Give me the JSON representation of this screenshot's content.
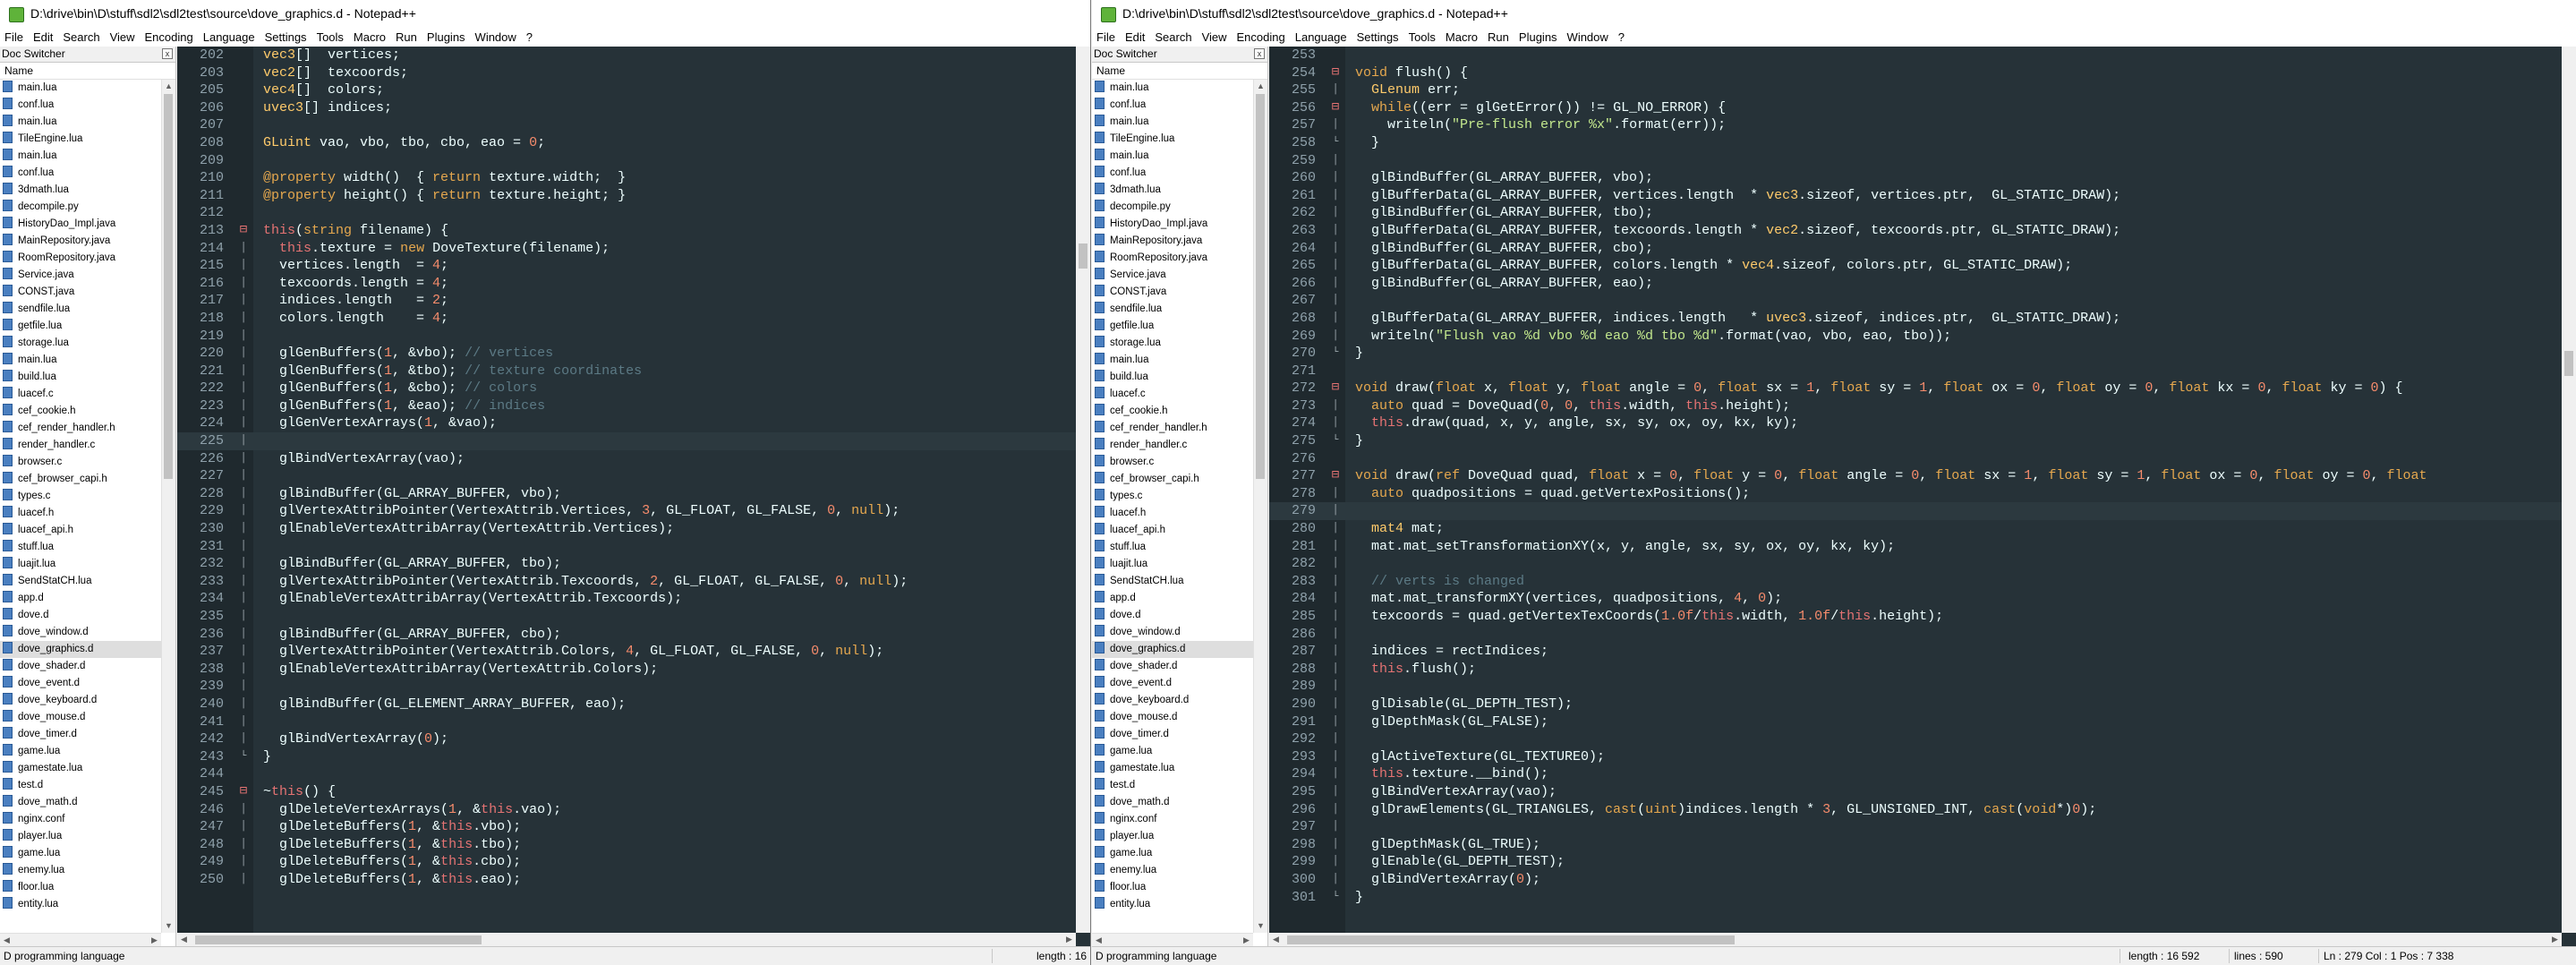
{
  "left": {
    "title": "D:\\drive\\bin\\D\\stuff\\sdl2\\sdl2test\\source\\dove_graphics.d - Notepad++",
    "menu": [
      "File",
      "Edit",
      "Search",
      "View",
      "Encoding",
      "Language",
      "Settings",
      "Tools",
      "Macro",
      "Run",
      "Plugins",
      "Window",
      "?"
    ],
    "panel": {
      "title": "Doc Switcher",
      "close": "x",
      "column": "Name",
      "items": [
        "main.lua",
        "conf.lua",
        "main.lua",
        "TileEngine.lua",
        "main.lua",
        "conf.lua",
        "3dmath.lua",
        "decompile.py",
        "HistoryDao_Impl.java",
        "MainRepository.java",
        "RoomRepository.java",
        "Service.java",
        "CONST.java",
        "sendfile.lua",
        "getfile.lua",
        "storage.lua",
        "main.lua",
        "build.lua",
        "luacef.c",
        "cef_cookie.h",
        "cef_render_handler.h",
        "render_handler.c",
        "browser.c",
        "cef_browser_capi.h",
        "types.c",
        "luacef.h",
        "luacef_api.h",
        "stuff.lua",
        "luajit.lua",
        "SendStatCH.lua",
        "app.d",
        "dove.d",
        "dove_window.d",
        "dove_graphics.d",
        "dove_shader.d",
        "dove_event.d",
        "dove_keyboard.d",
        "dove_mouse.d",
        "dove_timer.d",
        "game.lua",
        "gamestate.lua",
        "test.d",
        "dove_math.d",
        "nginx.conf",
        "player.lua",
        "game.lua",
        "enemy.lua",
        "floor.lua",
        "entity.lua"
      ],
      "active_index": 33
    },
    "status": {
      "lang": "D programming language",
      "length": "length : 16"
    },
    "lines": [
      {
        "n": "202",
        "f": "",
        "h": "<span class=\"t\">vec3</span>[]  vertices;"
      },
      {
        "n": "203",
        "f": "",
        "h": "<span class=\"t\">vec2</span>[]  texcoords;"
      },
      {
        "n": "205",
        "f": "",
        "h": "<span class=\"t\">vec4</span>[]  colors;"
      },
      {
        "n": "206",
        "f": "",
        "h": "<span class=\"t\">uvec3</span>[] indices;"
      },
      {
        "n": "207",
        "f": "",
        "h": ""
      },
      {
        "n": "208",
        "f": "",
        "h": "<span class=\"t\">GLuint</span> vao, vbo, tbo, cbo, eao = <span class=\"n\">0</span>;"
      },
      {
        "n": "209",
        "f": "",
        "h": ""
      },
      {
        "n": "210",
        "f": "",
        "h": "<span class=\"k\">@property</span> width()  { <span class=\"k\">return</span> texture.width;  }"
      },
      {
        "n": "211",
        "f": "",
        "h": "<span class=\"k\">@property</span> height() { <span class=\"k\">return</span> texture.height; }"
      },
      {
        "n": "212",
        "f": "",
        "h": ""
      },
      {
        "n": "213",
        "f": "start",
        "h": "<span class=\"r\">this</span>(<span class=\"k\">string</span> filename) {"
      },
      {
        "n": "214",
        "f": "bar",
        "h": "  <span class=\"r\">this</span>.texture = <span class=\"k\">new</span> DoveTexture(filename);"
      },
      {
        "n": "215",
        "f": "bar",
        "h": "  vertices.length  = <span class=\"n\">4</span>;"
      },
      {
        "n": "216",
        "f": "bar",
        "h": "  texcoords.length = <span class=\"n\">4</span>;"
      },
      {
        "n": "217",
        "f": "bar",
        "h": "  indices.length   = <span class=\"n\">2</span>;"
      },
      {
        "n": "218",
        "f": "bar",
        "h": "  colors.length    = <span class=\"n\">4</span>;"
      },
      {
        "n": "219",
        "f": "bar",
        "h": ""
      },
      {
        "n": "220",
        "f": "bar",
        "h": "  glGenBuffers(<span class=\"n\">1</span>, &amp;vbo); <span class=\"c\">// vertices</span>"
      },
      {
        "n": "221",
        "f": "bar",
        "h": "  glGenBuffers(<span class=\"n\">1</span>, &amp;tbo); <span class=\"c\">// texture coordinates</span>"
      },
      {
        "n": "222",
        "f": "bar",
        "h": "  glGenBuffers(<span class=\"n\">1</span>, &amp;cbo); <span class=\"c\">// colors</span>"
      },
      {
        "n": "223",
        "f": "bar",
        "h": "  glGenBuffers(<span class=\"n\">1</span>, &amp;eao); <span class=\"c\">// indices</span>"
      },
      {
        "n": "224",
        "f": "bar",
        "h": "  glGenVertexArrays(<span class=\"n\">1</span>, &amp;vao);"
      },
      {
        "n": "225",
        "f": "bar",
        "h": "",
        "caret": true
      },
      {
        "n": "226",
        "f": "bar",
        "h": "  glBindVertexArray(vao);"
      },
      {
        "n": "227",
        "f": "bar",
        "h": ""
      },
      {
        "n": "228",
        "f": "bar",
        "h": "  glBindBuffer(GL_ARRAY_BUFFER, vbo);"
      },
      {
        "n": "229",
        "f": "bar",
        "h": "  glVertexAttribPointer(VertexAttrib.Vertices, <span class=\"n\">3</span>, GL_FLOAT, GL_FALSE, <span class=\"n\">0</span>, <span class=\"k\">null</span>);"
      },
      {
        "n": "230",
        "f": "bar",
        "h": "  glEnableVertexAttribArray(VertexAttrib.Vertices);"
      },
      {
        "n": "231",
        "f": "bar",
        "h": ""
      },
      {
        "n": "232",
        "f": "bar",
        "h": "  glBindBuffer(GL_ARRAY_BUFFER, tbo);"
      },
      {
        "n": "233",
        "f": "bar",
        "h": "  glVertexAttribPointer(VertexAttrib.Texcoords, <span class=\"n\">2</span>, GL_FLOAT, GL_FALSE, <span class=\"n\">0</span>, <span class=\"k\">null</span>);"
      },
      {
        "n": "234",
        "f": "bar",
        "h": "  glEnableVertexAttribArray(VertexAttrib.Texcoords);"
      },
      {
        "n": "235",
        "f": "bar",
        "h": ""
      },
      {
        "n": "236",
        "f": "bar",
        "h": "  glBindBuffer(GL_ARRAY_BUFFER, cbo);"
      },
      {
        "n": "237",
        "f": "bar",
        "h": "  glVertexAttribPointer(VertexAttrib.Colors, <span class=\"n\">4</span>, GL_FLOAT, GL_FALSE, <span class=\"n\">0</span>, <span class=\"k\">null</span>);"
      },
      {
        "n": "238",
        "f": "bar",
        "h": "  glEnableVertexAttribArray(VertexAttrib.Colors);"
      },
      {
        "n": "239",
        "f": "bar",
        "h": ""
      },
      {
        "n": "240",
        "f": "bar",
        "h": "  glBindBuffer(GL_ELEMENT_ARRAY_BUFFER, eao);"
      },
      {
        "n": "241",
        "f": "bar",
        "h": ""
      },
      {
        "n": "242",
        "f": "bar",
        "h": "  glBindVertexArray(<span class=\"n\">0</span>);"
      },
      {
        "n": "243",
        "f": "end",
        "h": "}"
      },
      {
        "n": "244",
        "f": "",
        "h": ""
      },
      {
        "n": "245",
        "f": "start",
        "h": "~<span class=\"r\">this</span>() {"
      },
      {
        "n": "246",
        "f": "bar",
        "h": "  glDeleteVertexArrays(<span class=\"n\">1</span>, &amp;<span class=\"r\">this</span>.vao);"
      },
      {
        "n": "247",
        "f": "bar",
        "h": "  glDeleteBuffers(<span class=\"n\">1</span>, &amp;<span class=\"r\">this</span>.vbo);"
      },
      {
        "n": "248",
        "f": "bar",
        "h": "  glDeleteBuffers(<span class=\"n\">1</span>, &amp;<span class=\"r\">this</span>.tbo);"
      },
      {
        "n": "249",
        "f": "bar",
        "h": "  glDeleteBuffers(<span class=\"n\">1</span>, &amp;<span class=\"r\">this</span>.cbo);"
      },
      {
        "n": "250",
        "f": "bar",
        "h": "  glDeleteBuffers(<span class=\"n\">1</span>, &amp;<span class=\"r\">this</span>.eao);"
      }
    ]
  },
  "right": {
    "title": "D:\\drive\\bin\\D\\stuff\\sdl2\\sdl2test\\source\\dove_graphics.d - Notepad++",
    "menu": [
      "File",
      "Edit",
      "Search",
      "View",
      "Encoding",
      "Language",
      "Settings",
      "Tools",
      "Macro",
      "Run",
      "Plugins",
      "Window",
      "?"
    ],
    "panel": {
      "title": "Doc Switcher",
      "close": "x",
      "column": "Name",
      "items": [
        "main.lua",
        "conf.lua",
        "main.lua",
        "TileEngine.lua",
        "main.lua",
        "conf.lua",
        "3dmath.lua",
        "decompile.py",
        "HistoryDao_Impl.java",
        "MainRepository.java",
        "RoomRepository.java",
        "Service.java",
        "CONST.java",
        "sendfile.lua",
        "getfile.lua",
        "storage.lua",
        "main.lua",
        "build.lua",
        "luacef.c",
        "cef_cookie.h",
        "cef_render_handler.h",
        "render_handler.c",
        "browser.c",
        "cef_browser_capi.h",
        "types.c",
        "luacef.h",
        "luacef_api.h",
        "stuff.lua",
        "luajit.lua",
        "SendStatCH.lua",
        "app.d",
        "dove.d",
        "dove_window.d",
        "dove_graphics.d",
        "dove_shader.d",
        "dove_event.d",
        "dove_keyboard.d",
        "dove_mouse.d",
        "dove_timer.d",
        "game.lua",
        "gamestate.lua",
        "test.d",
        "dove_math.d",
        "nginx.conf",
        "player.lua",
        "game.lua",
        "enemy.lua",
        "floor.lua",
        "entity.lua"
      ],
      "active_index": 33
    },
    "status": {
      "lang": "D programming language",
      "length": "length : 16 592",
      "lines": "lines : 590",
      "pos": "Ln : 279   Col : 1   Pos : 7 338"
    },
    "lines": [
      {
        "n": "253",
        "f": "",
        "h": ""
      },
      {
        "n": "254",
        "f": "start",
        "h": "<span class=\"k\">void</span> flush() {"
      },
      {
        "n": "255",
        "f": "bar",
        "h": "  <span class=\"t\">GLenum</span> err;"
      },
      {
        "n": "256",
        "f": "start",
        "h": "  <span class=\"k\">while</span>((err = glGetError()) != GL_NO_ERROR) {"
      },
      {
        "n": "257",
        "f": "bar",
        "h": "    writeln(<span class=\"s\">\"Pre-flush error %x\"</span>.format(err));"
      },
      {
        "n": "258",
        "f": "end",
        "h": "  }"
      },
      {
        "n": "259",
        "f": "bar",
        "h": ""
      },
      {
        "n": "260",
        "f": "bar",
        "h": "  glBindBuffer(GL_ARRAY_BUFFER, vbo);"
      },
      {
        "n": "261",
        "f": "bar",
        "h": "  glBufferData(GL_ARRAY_BUFFER, vertices.length  * <span class=\"t\">vec3</span>.sizeof, vertices.ptr,  GL_STATIC_DRAW);"
      },
      {
        "n": "262",
        "f": "bar",
        "h": "  glBindBuffer(GL_ARRAY_BUFFER, tbo);"
      },
      {
        "n": "263",
        "f": "bar",
        "h": "  glBufferData(GL_ARRAY_BUFFER, texcoords.length * <span class=\"t\">vec2</span>.sizeof, texcoords.ptr, GL_STATIC_DRAW);"
      },
      {
        "n": "264",
        "f": "bar",
        "h": "  glBindBuffer(GL_ARRAY_BUFFER, cbo);"
      },
      {
        "n": "265",
        "f": "bar",
        "h": "  glBufferData(GL_ARRAY_BUFFER, colors.length * <span class=\"t\">vec4</span>.sizeof, colors.ptr, GL_STATIC_DRAW);"
      },
      {
        "n": "266",
        "f": "bar",
        "h": "  glBindBuffer(GL_ARRAY_BUFFER, eao);"
      },
      {
        "n": "267",
        "f": "bar",
        "h": ""
      },
      {
        "n": "268",
        "f": "bar",
        "h": "  glBufferData(GL_ARRAY_BUFFER, indices.length   * <span class=\"t\">uvec3</span>.sizeof, indices.ptr,  GL_STATIC_DRAW);"
      },
      {
        "n": "269",
        "f": "bar",
        "h": "  writeln(<span class=\"s\">\"Flush vao %d vbo %d eao %d tbo %d\"</span>.format(vao, vbo, eao, tbo));"
      },
      {
        "n": "270",
        "f": "end",
        "h": "}"
      },
      {
        "n": "271",
        "f": "",
        "h": ""
      },
      {
        "n": "272",
        "f": "start",
        "h": "<span class=\"k\">void</span> draw(<span class=\"k\">float</span> x, <span class=\"k\">float</span> y, <span class=\"k\">float</span> angle = <span class=\"n\">0</span>, <span class=\"k\">float</span> sx = <span class=\"n\">1</span>, <span class=\"k\">float</span> sy = <span class=\"n\">1</span>, <span class=\"k\">float</span> ox = <span class=\"n\">0</span>, <span class=\"k\">float</span> oy = <span class=\"n\">0</span>, <span class=\"k\">float</span> kx = <span class=\"n\">0</span>, <span class=\"k\">float</span> ky = <span class=\"n\">0</span>) {"
      },
      {
        "n": "273",
        "f": "bar",
        "h": "  <span class=\"k\">auto</span> quad = DoveQuad(<span class=\"n\">0</span>, <span class=\"n\">0</span>, <span class=\"r\">this</span>.width, <span class=\"r\">this</span>.height);"
      },
      {
        "n": "274",
        "f": "bar",
        "h": "  <span class=\"r\">this</span>.draw(quad, x, y, angle, sx, sy, ox, oy, kx, ky);"
      },
      {
        "n": "275",
        "f": "end",
        "h": "}"
      },
      {
        "n": "276",
        "f": "",
        "h": ""
      },
      {
        "n": "277",
        "f": "start",
        "h": "<span class=\"k\">void</span> draw(<span class=\"k\">ref</span> DoveQuad quad, <span class=\"k\">float</span> x = <span class=\"n\">0</span>, <span class=\"k\">float</span> y = <span class=\"n\">0</span>, <span class=\"k\">float</span> angle = <span class=\"n\">0</span>, <span class=\"k\">float</span> sx = <span class=\"n\">1</span>, <span class=\"k\">float</span> sy = <span class=\"n\">1</span>, <span class=\"k\">float</span> ox = <span class=\"n\">0</span>, <span class=\"k\">float</span> oy = <span class=\"n\">0</span>, <span class=\"k\">float</span>"
      },
      {
        "n": "278",
        "f": "bar",
        "h": "  <span class=\"k\">auto</span> quadpositions = quad.getVertexPositions();"
      },
      {
        "n": "279",
        "f": "bar",
        "h": "",
        "caret": true
      },
      {
        "n": "280",
        "f": "bar",
        "h": "  <span class=\"t\">mat4</span> mat;"
      },
      {
        "n": "281",
        "f": "bar",
        "h": "  mat.mat_setTransformationXY(x, y, angle, sx, sy, ox, oy, kx, ky);"
      },
      {
        "n": "282",
        "f": "bar",
        "h": ""
      },
      {
        "n": "283",
        "f": "bar",
        "h": "  <span class=\"c\">// verts is changed</span>"
      },
      {
        "n": "284",
        "f": "bar",
        "h": "  mat.mat_transformXY(vertices, quadpositions, <span class=\"n\">4</span>, <span class=\"n\">0</span>);"
      },
      {
        "n": "285",
        "f": "bar",
        "h": "  texcoords = quad.getVertexTexCoords(<span class=\"n\">1.0f</span>/<span class=\"r\">this</span>.width, <span class=\"n\">1.0f</span>/<span class=\"r\">this</span>.height);"
      },
      {
        "n": "286",
        "f": "bar",
        "h": ""
      },
      {
        "n": "287",
        "f": "bar",
        "h": "  indices = rectIndices;"
      },
      {
        "n": "288",
        "f": "bar",
        "h": "  <span class=\"r\">this</span>.flush();"
      },
      {
        "n": "289",
        "f": "bar",
        "h": ""
      },
      {
        "n": "290",
        "f": "bar",
        "h": "  glDisable(GL_DEPTH_TEST);"
      },
      {
        "n": "291",
        "f": "bar",
        "h": "  glDepthMask(GL_FALSE);"
      },
      {
        "n": "292",
        "f": "bar",
        "h": ""
      },
      {
        "n": "293",
        "f": "bar",
        "h": "  glActiveTexture(GL_TEXTURE0);"
      },
      {
        "n": "294",
        "f": "bar",
        "h": "  <span class=\"r\">this</span>.texture.__bind();"
      },
      {
        "n": "295",
        "f": "bar",
        "h": "  glBindVertexArray(vao);"
      },
      {
        "n": "296",
        "f": "bar",
        "h": "  glDrawElements(GL_TRIANGLES, <span class=\"k\">cast</span>(<span class=\"k\">uint</span>)indices.length * <span class=\"n\">3</span>, GL_UNSIGNED_INT, <span class=\"k\">cast</span>(<span class=\"k\">void</span>*)<span class=\"n\">0</span>);"
      },
      {
        "n": "297",
        "f": "bar",
        "h": ""
      },
      {
        "n": "298",
        "f": "bar",
        "h": "  glDepthMask(GL_TRUE);"
      },
      {
        "n": "299",
        "f": "bar",
        "h": "  glEnable(GL_DEPTH_TEST);"
      },
      {
        "n": "300",
        "f": "bar",
        "h": "  glBindVertexArray(<span class=\"n\">0</span>);"
      },
      {
        "n": "301",
        "f": "end",
        "h": "}"
      }
    ]
  }
}
